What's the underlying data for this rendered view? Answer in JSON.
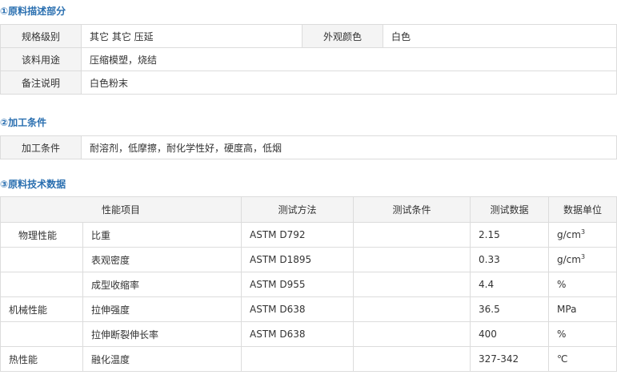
{
  "sections": {
    "s1_title": "①原料描述部分",
    "s2_title": "②加工条件",
    "s3_title": "③原料技术数据"
  },
  "description": {
    "grade_label": "规格级别",
    "grade_value": "其它 其它 压延",
    "appearance_label": "外观颜色",
    "appearance_value": "白色",
    "usage_label": "该料用途",
    "usage_value": "压缩模塑，烧结",
    "remark_label": "备注说明",
    "remark_value": "白色粉末"
  },
  "processing": {
    "label": "加工条件",
    "value": "耐溶剂，低摩擦，耐化学性好，硬度高，低烟"
  },
  "tech": {
    "headers": [
      "性能项目",
      "测试方法",
      "测试条件",
      "测试数据",
      "数据单位"
    ],
    "rows": [
      {
        "cat": "物理性能",
        "item": "比重",
        "method": "ASTM D792",
        "cond": "",
        "data": "2.15",
        "unit": "g/cm",
        "sup": "3"
      },
      {
        "cat": "",
        "item": "表观密度",
        "method": "ASTM D1895",
        "cond": "",
        "data": "0.33",
        "unit": "g/cm",
        "sup": "3"
      },
      {
        "cat": "",
        "item": "成型收缩率",
        "method": "ASTM D955",
        "cond": "",
        "data": "4.4",
        "unit": "%",
        "sup": ""
      },
      {
        "cat": "机械性能",
        "item": "拉伸强度",
        "method": "ASTM D638",
        "cond": "",
        "data": "36.5",
        "unit": "MPa",
        "sup": ""
      },
      {
        "cat": "",
        "item": "拉伸断裂伸长率",
        "method": "ASTM D638",
        "cond": "",
        "data": "400",
        "unit": "%",
        "sup": ""
      },
      {
        "cat": "热性能",
        "item": "融化温度",
        "method": "",
        "cond": "",
        "data": "327-342",
        "unit": "℃",
        "sup": ""
      }
    ]
  }
}
